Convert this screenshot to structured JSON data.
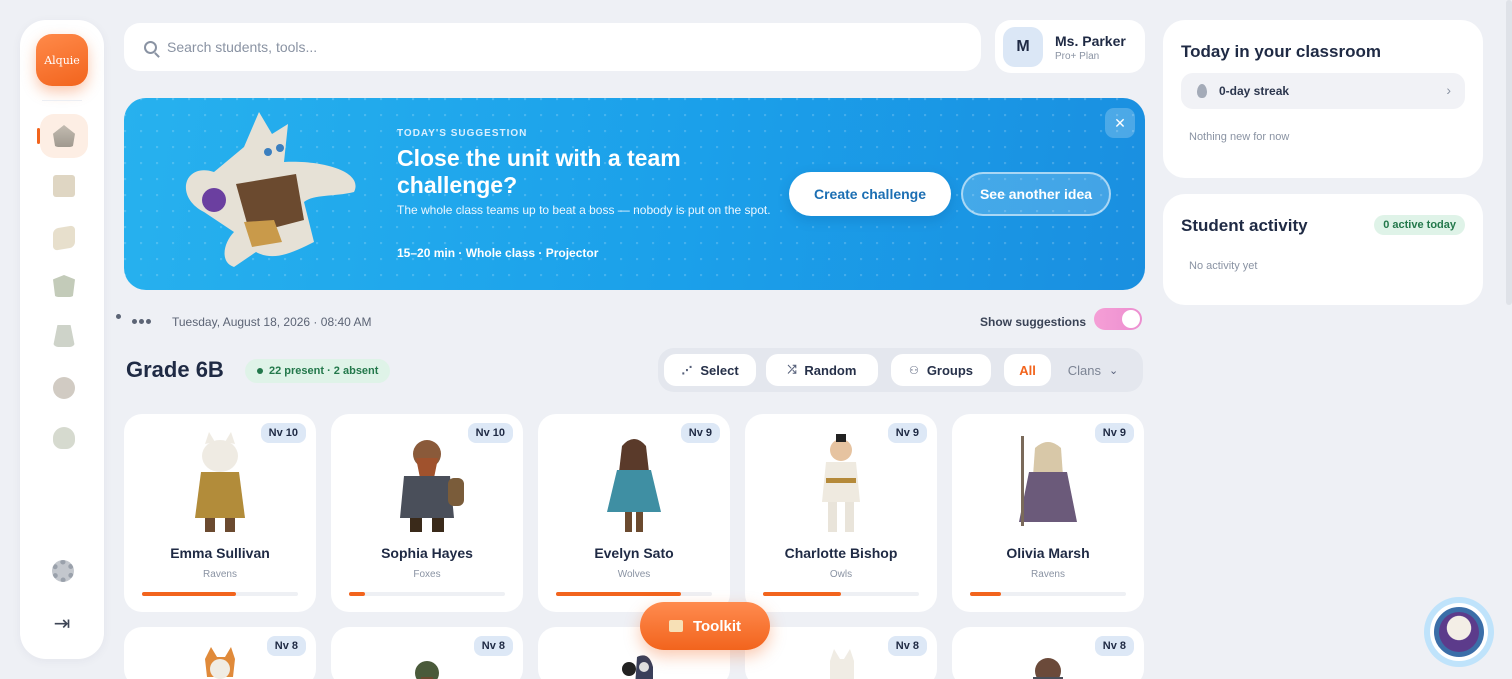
{
  "app": {
    "logo_text": "Alquie"
  },
  "search": {
    "placeholder": "Search students, tools..."
  },
  "profile": {
    "initial": "M",
    "name": "Ms. Parker",
    "plan": "Pro+ Plan"
  },
  "hero": {
    "kicker": "TODAY'S SUGGESTION",
    "title": "Close the unit with a team challenge?",
    "description": "The whole class teams up to beat a boss — nobody is put on the spot.",
    "meta": "15–20 min · Whole class · Projector",
    "primary_label": "Create challenge",
    "secondary_label": "See another idea",
    "close_glyph": "✕"
  },
  "status": {
    "date": "Tuesday, August 18, 2026 · 08:40 AM",
    "suggestions_label": "Show suggestions",
    "suggestions_on": true
  },
  "class": {
    "title": "Grade 6B",
    "attendance": "22 present · 2 absent"
  },
  "filters": {
    "select": "Select",
    "random": "Random",
    "groups": "Groups",
    "all": "All",
    "clans": "Clans"
  },
  "students": [
    {
      "name": "Emma Sullivan",
      "clan": "Ravens",
      "level": "Nv 10",
      "xp": 0.6
    },
    {
      "name": "Sophia Hayes",
      "clan": "Foxes",
      "level": "Nv 10",
      "xp": 0.1
    },
    {
      "name": "Evelyn Sato",
      "clan": "Wolves",
      "level": "Nv 9",
      "xp": 0.8
    },
    {
      "name": "Charlotte Bishop",
      "clan": "Owls",
      "level": "Nv 9",
      "xp": 0.5
    },
    {
      "name": "Olivia Marsh",
      "clan": "Ravens",
      "level": "Nv 9",
      "xp": 0.2
    }
  ],
  "students_row2": [
    {
      "level": "Nv 8"
    },
    {
      "level": "Nv 8"
    },
    {
      "level": ""
    },
    {
      "level": "Nv 8"
    },
    {
      "level": "Nv 8"
    }
  ],
  "toolkit": {
    "label": "Toolkit"
  },
  "today_panel": {
    "title": "Today in your classroom",
    "streak": "0-day streak",
    "empty": "Nothing new for now"
  },
  "activity_panel": {
    "title": "Student activity",
    "badge": "0 active today",
    "empty": "No activity yet"
  },
  "colors": {
    "accent": "#f2641d",
    "hero_blue": "#1ba0ea",
    "success": "#23784b"
  }
}
